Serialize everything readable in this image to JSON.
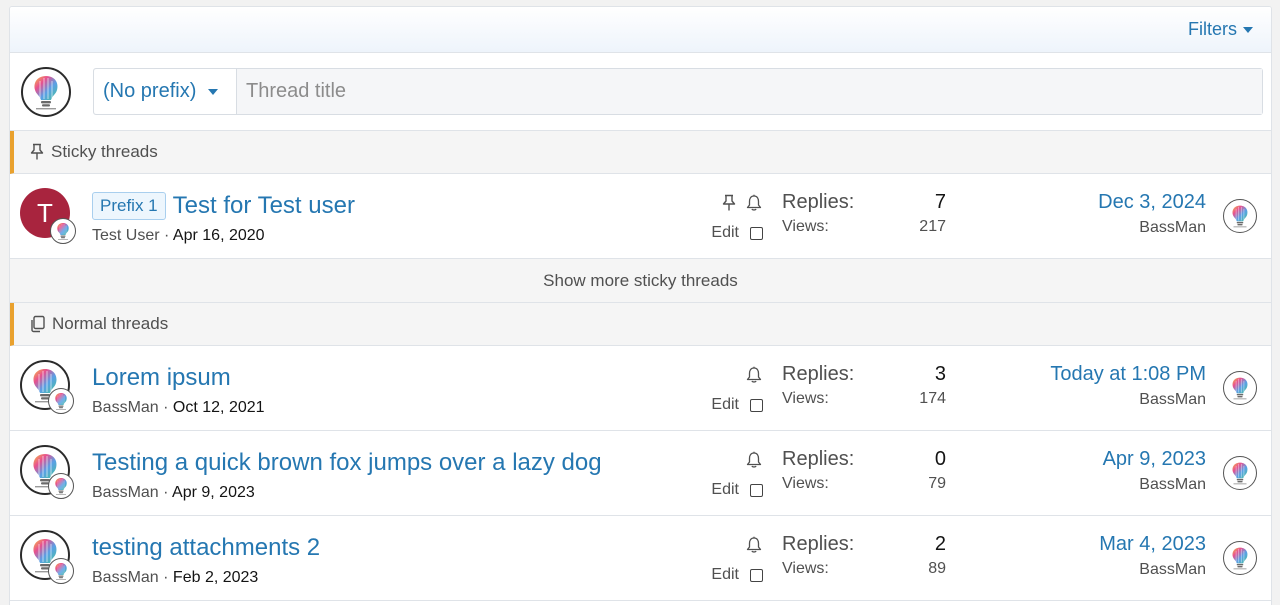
{
  "filters": {
    "label": "Filters"
  },
  "quick_thread": {
    "prefix_label": "(No prefix)",
    "title_placeholder": "Thread title"
  },
  "sticky_section": {
    "label": "Sticky threads"
  },
  "show_more": {
    "label": "Show more sticky threads"
  },
  "normal_section": {
    "label": "Normal threads"
  },
  "sticky_threads": [
    {
      "avatar_letter": "T",
      "avatar_color": "#a8243e",
      "prefix": "Prefix 1",
      "title": "Test for Test user",
      "author": "Test User",
      "separator": " · ",
      "start_date": "Apr 16, 2020",
      "edit_label": "Edit",
      "replies_label": "Replies:",
      "replies": "7",
      "views_label": "Views:",
      "views": "217",
      "latest_date": "Dec 3, 2024",
      "latest_user": "BassMan"
    }
  ],
  "normal_threads": [
    {
      "title": "Lorem ipsum",
      "author": "BassMan",
      "separator": " · ",
      "start_date": "Oct 12, 2021",
      "edit_label": "Edit",
      "replies_label": "Replies:",
      "replies": "3",
      "views_label": "Views:",
      "views": "174",
      "latest_date": "Today at 1:08 PM",
      "latest_user": "BassMan"
    },
    {
      "title": "Testing a quick brown fox jumps over a lazy dog",
      "author": "BassMan",
      "separator": " · ",
      "start_date": "Apr 9, 2023",
      "edit_label": "Edit",
      "replies_label": "Replies:",
      "replies": "0",
      "views_label": "Views:",
      "views": "79",
      "latest_date": "Apr 9, 2023",
      "latest_user": "BassMan"
    },
    {
      "title": "testing attachments 2",
      "author": "BassMan",
      "separator": " · ",
      "start_date": "Feb 2, 2023",
      "edit_label": "Edit",
      "replies_label": "Replies:",
      "replies": "2",
      "views_label": "Views:",
      "views": "89",
      "latest_date": "Mar 4, 2023",
      "latest_user": "BassMan"
    }
  ],
  "colors": {
    "link": "#2577b1",
    "section_accent": "#e9a12e",
    "avatar_red": "#a8243e"
  },
  "icons": [
    "caret-down-icon",
    "pin-icon",
    "bell-icon",
    "copy-icon",
    "bulb-avatar-icon"
  ]
}
